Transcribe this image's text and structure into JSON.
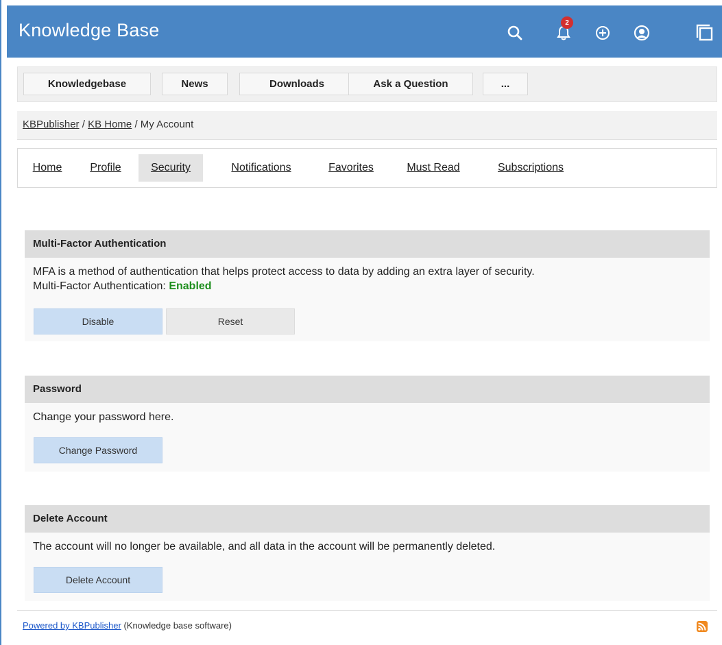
{
  "header": {
    "title": "Knowledge Base",
    "notifications_count": "2",
    "icons": [
      "search-icon",
      "bell-icon",
      "plus-circle-icon",
      "user-icon",
      "window-icon"
    ],
    "bg_color": "#4a86c5"
  },
  "topnav": {
    "items": [
      "Knowledgebase",
      "News",
      "Downloads",
      "Ask a Question",
      "..."
    ]
  },
  "breadcrumb": {
    "root": "KBPublisher",
    "sep1": "/",
    "home": "KB Home",
    "sep2": "/",
    "current": "My Account"
  },
  "tabs": {
    "items": [
      "Home",
      "Profile",
      "Security",
      "Notifications",
      "Favorites",
      "Must Read",
      "Subscriptions"
    ],
    "active": "Security"
  },
  "mfa": {
    "title": "Multi-Factor Authentication",
    "description": "MFA is a method of authentication that helps protect access to data by adding an extra layer of security.",
    "status_label": "Multi-Factor Authentication:",
    "status_value": "Enabled",
    "disable_label": "Disable",
    "reset_label": "Reset"
  },
  "password": {
    "title": "Password",
    "description": "Change your password here.",
    "button_label": "Change Password"
  },
  "delete_account": {
    "title": "Delete Account",
    "description": "The account will no longer be available, and all data in the account will be permanently deleted.",
    "button_label": "Delete Account"
  },
  "footer": {
    "link_text": "Powered by KBPublisher",
    "suffix": "(Knowledge base software)",
    "rss_icon": "rss-icon"
  }
}
